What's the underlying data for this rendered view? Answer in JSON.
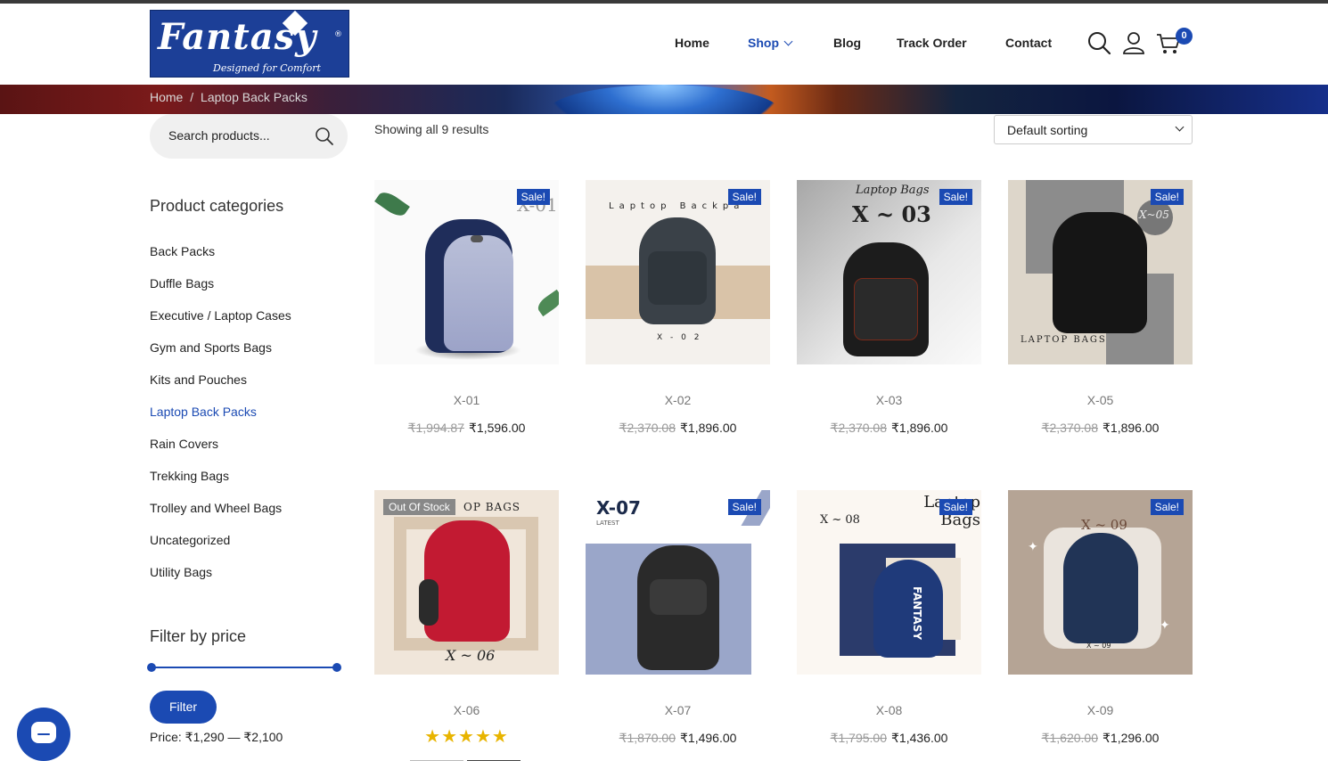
{
  "brand": {
    "logo_text": "Fantasy",
    "logo_tagline": "Designed for Comfort",
    "logo_small": "Fantasy",
    "logo_reg": "®"
  },
  "nav": {
    "items": [
      {
        "label": "Home"
      },
      {
        "label": "Shop"
      },
      {
        "label": "Blog"
      },
      {
        "label": "Track Order"
      },
      {
        "label": "Contact"
      }
    ],
    "cart_count": "0"
  },
  "breadcrumb": {
    "home": "Home",
    "separator": "/",
    "current": "Laptop Back Packs"
  },
  "search": {
    "placeholder": "Search products..."
  },
  "sidebar": {
    "categories_title": "Product categories",
    "categories": [
      {
        "label": "Back Packs"
      },
      {
        "label": "Duffle Bags"
      },
      {
        "label": "Executive / Laptop Cases"
      },
      {
        "label": "Gym and Sports Bags"
      },
      {
        "label": "Kits and Pouches"
      },
      {
        "label": "Laptop Back Packs"
      },
      {
        "label": "Rain Covers"
      },
      {
        "label": "Trekking Bags"
      },
      {
        "label": "Trolley and Wheel Bags"
      },
      {
        "label": "Uncategorized"
      },
      {
        "label": "Utility Bags"
      }
    ],
    "active_category": "Laptop Back Packs",
    "price_filter": {
      "title": "Filter by price",
      "button": "Filter",
      "label": "Price: ₹1,290 — ₹2,100"
    }
  },
  "listing": {
    "results_text": "Showing all 9 results",
    "sort_selected": "Default sorting"
  },
  "products": [
    {
      "name": "X-01",
      "old_price": "₹1,994.87",
      "price": "₹1,596.00",
      "badge": "Sale!",
      "image_text": "X-01"
    },
    {
      "name": "X-02",
      "old_price": "₹2,370.08",
      "price": "₹1,896.00",
      "badge": "Sale!",
      "image_text": "Laptop Backpa",
      "image_code": "X - 0 2"
    },
    {
      "name": "X-03",
      "old_price": "₹2,370.08",
      "price": "₹1,896.00",
      "badge": "Sale!",
      "image_script": "Laptop Bags",
      "image_text": "X ~ 03"
    },
    {
      "name": "X-05",
      "old_price": "₹2,370.08",
      "price": "₹1,896.00",
      "badge": "Sale!",
      "image_script": "X~05",
      "image_text": "LAPTOP BAGS"
    },
    {
      "name": "X-06",
      "badge": "Out Of Stock",
      "image_text": "OP BAGS",
      "image_script": "X ~ 06",
      "rating": 5,
      "stars": "★★★★★"
    },
    {
      "name": "X-07",
      "old_price": "₹1,870.00",
      "price": "₹1,496.00",
      "badge": "Sale!",
      "image_text": "X-07",
      "image_sub": "LATEST"
    },
    {
      "name": "X-08",
      "old_price": "₹1,795.00",
      "price": "₹1,436.00",
      "badge": "Sale!",
      "image_text": "X ~ 08",
      "image_script": "Laptop Bags",
      "image_brand": "FANTASY"
    },
    {
      "name": "X-09",
      "old_price": "₹1,620.00",
      "price": "₹1,296.00",
      "badge": "Sale!",
      "image_script": "X ~ 09",
      "image_code": "X ~ 09"
    }
  ],
  "colors": {
    "accent": "#1b4ab3",
    "sale_badge": "#1b4ab3",
    "oos_badge": "#888888",
    "stars": "#e8b400"
  },
  "icons": [
    "search-icon",
    "user-icon",
    "cart-icon",
    "chevron-down-icon",
    "chat-icon"
  ]
}
